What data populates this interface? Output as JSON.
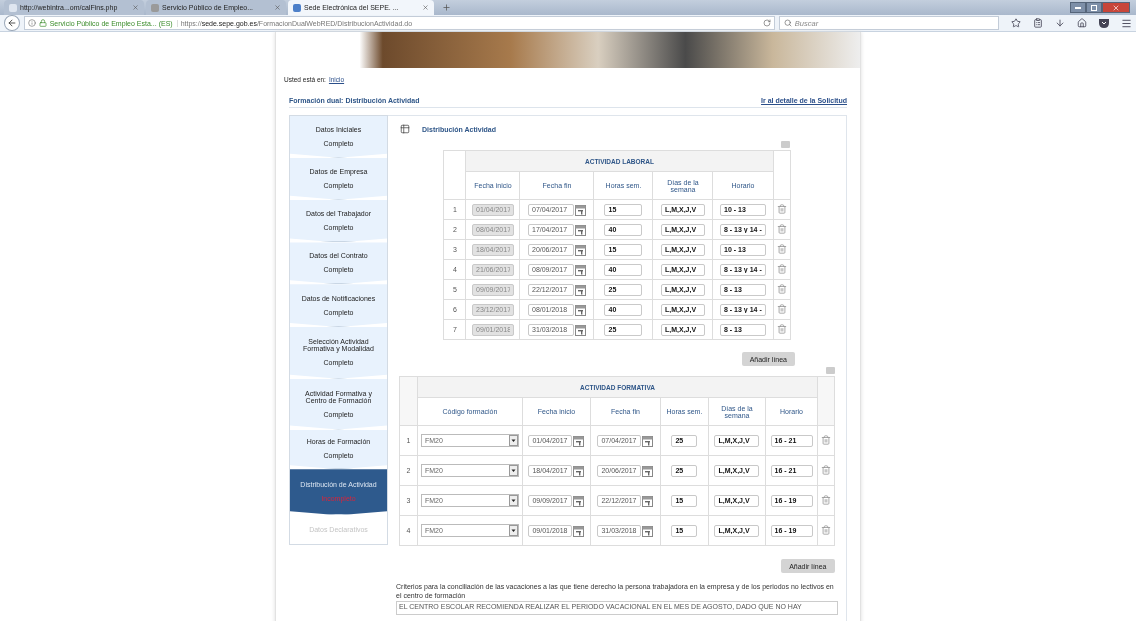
{
  "browser": {
    "tabs": [
      {
        "label": "http://webintra...om/calFins.php",
        "selected": false
      },
      {
        "label": "Servicio Público de Empleo...",
        "selected": false
      },
      {
        "label": "Sede Electrónica del SEPE. ...",
        "selected": true
      }
    ],
    "site_identity": "Servicio Público de Empleo Esta... (ES)",
    "url": "https://**sede.sepe.gob.es**/FormacionDualWebRED/DistribucionActividad.do",
    "search_placeholder": "Buscar"
  },
  "breadcrumb": {
    "label": "Usted está en:",
    "link": "Inicio"
  },
  "heading": {
    "title": "Formación dual: Distribución Actividad",
    "detail_link": "Ir al detalle de la Solicitud"
  },
  "steps": [
    {
      "title": "Datos Iniciales",
      "status": "Completo",
      "incomplete": false,
      "selected": false,
      "disabled": false
    },
    {
      "title": "Datos de Empresa",
      "status": "Completo",
      "incomplete": false,
      "selected": false,
      "disabled": false
    },
    {
      "title": "Datos del Trabajador",
      "status": "Completo",
      "incomplete": false,
      "selected": false,
      "disabled": false
    },
    {
      "title": "Datos del Contrato",
      "status": "Completo",
      "incomplete": false,
      "selected": false,
      "disabled": false
    },
    {
      "title": "Datos de Notificaciones",
      "status": "Completo",
      "incomplete": false,
      "selected": false,
      "disabled": false
    },
    {
      "title": "Selección Actividad Formativa y Modalidad",
      "status": "Completo",
      "incomplete": false,
      "selected": false,
      "disabled": false
    },
    {
      "title": "Actividad Formativa y Centro de Formación",
      "status": "Completo",
      "incomplete": false,
      "selected": false,
      "disabled": false
    },
    {
      "title": "Horas de Formación",
      "status": "Completo",
      "incomplete": false,
      "selected": false,
      "disabled": false
    },
    {
      "title": "Distribución de Actividad",
      "status": "Incompleto",
      "incomplete": true,
      "selected": true,
      "disabled": false
    },
    {
      "title": "Datos Declarativos",
      "selected": false,
      "disabled": true
    }
  ],
  "section_title": "Distribución Actividad",
  "labor": {
    "title": "ACTIVIDAD LABORAL",
    "columns": [
      "Fecha inicio",
      "Fecha fin",
      "Horas sem.",
      "Días de la semana",
      "Horario"
    ],
    "rows": [
      {
        "num": "1",
        "start": "01/04/2017",
        "start_disabled": true,
        "end": "07/04/2017",
        "hours": "15",
        "days": "L,M,X,J,V",
        "schedule": "10 - 13"
      },
      {
        "num": "2",
        "start": "08/04/2017",
        "start_disabled": true,
        "end": "17/04/2017",
        "hours": "40",
        "days": "L,M,X,J,V",
        "schedule": "8 - 13 y 14 -"
      },
      {
        "num": "3",
        "start": "18/04/2017",
        "start_disabled": true,
        "end": "20/06/2017",
        "hours": "15",
        "days": "L,M,X,J,V",
        "schedule": "10 - 13"
      },
      {
        "num": "4",
        "start": "21/06/2017",
        "start_disabled": true,
        "end": "08/09/2017",
        "hours": "40",
        "days": "L,M,X,J,V",
        "schedule": "8 - 13 y 14 -"
      },
      {
        "num": "5",
        "start": "09/09/2017",
        "start_disabled": true,
        "end": "22/12/2017",
        "hours": "25",
        "days": "L,M,X,J,V",
        "schedule": "8 - 13"
      },
      {
        "num": "6",
        "start": "23/12/2017",
        "start_disabled": true,
        "end": "08/01/2018",
        "hours": "40",
        "days": "L,M,X,J,V",
        "schedule": "8 - 13 y 14 -"
      },
      {
        "num": "7",
        "start": "09/01/2018",
        "start_disabled": true,
        "end": "31/03/2018",
        "hours": "25",
        "days": "L,M,X,J,V",
        "schedule": "8 - 13"
      }
    ],
    "add_button": "Añadir línea"
  },
  "training": {
    "title": "ACTIVIDAD FORMATIVA",
    "columns": [
      "Código formación",
      "Fecha inicio",
      "Fecha fin",
      "Horas sem.",
      "Días de la semana",
      "Horario"
    ],
    "rows": [
      {
        "num": "1",
        "code": "FM20",
        "start": "01/04/2017",
        "end": "07/04/2017",
        "hours": "25",
        "days": "L,M,X,J,V",
        "schedule": "16 - 21"
      },
      {
        "num": "2",
        "code": "FM20",
        "start": "18/04/2017",
        "end": "20/06/2017",
        "hours": "25",
        "days": "L,M,X,J,V",
        "schedule": "16 - 21"
      },
      {
        "num": "3",
        "code": "FM20",
        "start": "09/09/2017",
        "end": "22/12/2017",
        "hours": "15",
        "days": "L,M,X,J,V",
        "schedule": "16 - 19"
      },
      {
        "num": "4",
        "code": "FM20",
        "start": "09/01/2018",
        "end": "31/03/2018",
        "hours": "15",
        "days": "L,M,X,J,V",
        "schedule": "16 - 19"
      }
    ],
    "add_button": "Añadir línea"
  },
  "criteria": {
    "label": "Criterios para la conciliación de las vacaciones a las que tiene derecho la persona trabajadora en la empresa y de los periodos no lectivos en el centro de formación",
    "value": "EL CENTRO ESCOLAR RECOMIENDA REALIZAR EL PERIODO VACACIONAL EN EL MES DE AGOSTO, DADO QUE NO HAY"
  }
}
